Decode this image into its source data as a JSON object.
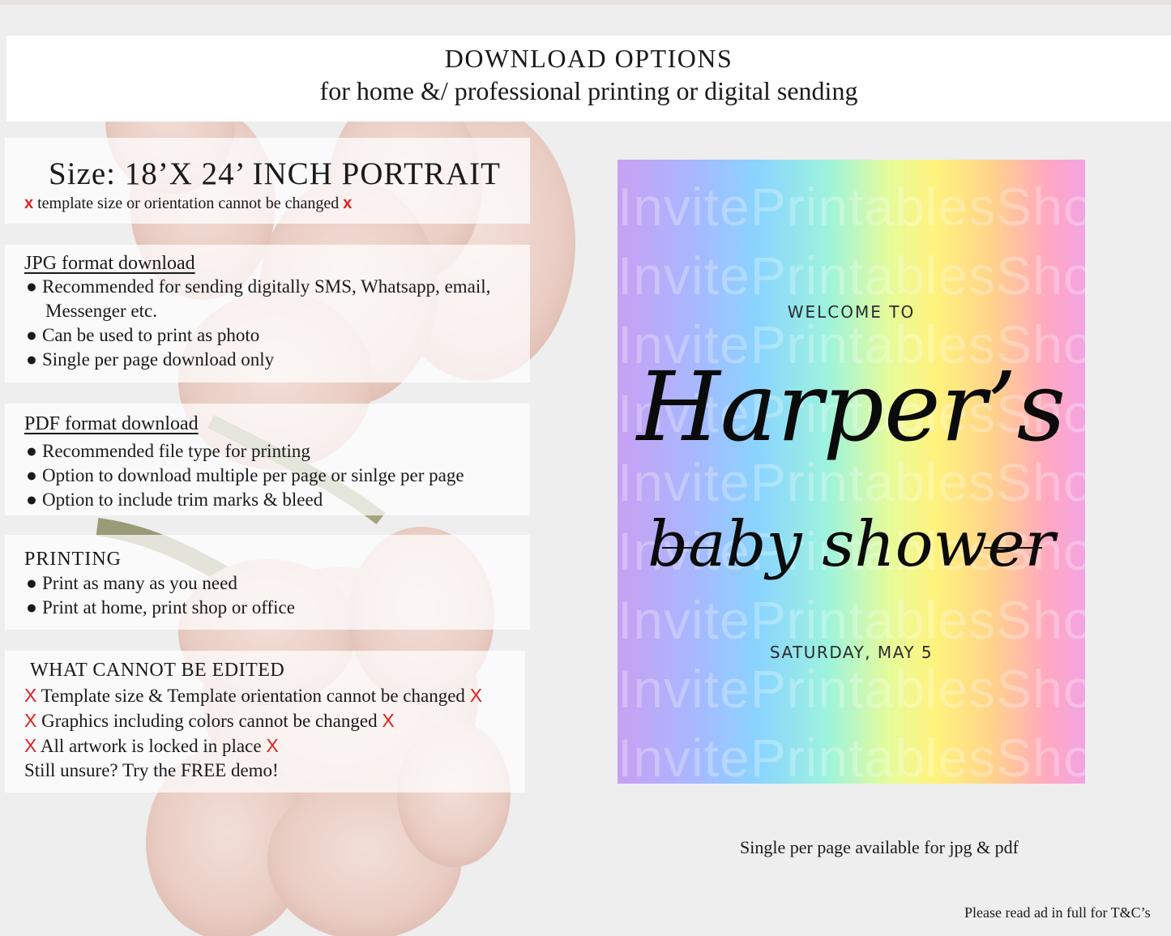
{
  "header": {
    "title": "DOWNLOAD OPTIONS",
    "subtitle": "for home &/ professional printing or digital sending"
  },
  "size_panel": {
    "title": "Size: 18’X 24’ INCH PORTRAIT",
    "note_mark": "x",
    "note": "template size or orientation cannot be changed"
  },
  "jpg_panel": {
    "title": "JPG format download",
    "bullet": "●",
    "items": [
      "Recommended for sending digitally SMS, Whatsapp, email,",
      "Messenger etc.",
      "Can be used to print as photo",
      "Single per page download only"
    ]
  },
  "pdf_panel": {
    "title": "PDF format download",
    "items": [
      "Recommended file type for printing",
      "Option to download multiple per page or sinlge per page",
      "Option to include trim marks & bleed"
    ]
  },
  "printing_panel": {
    "title": "PRINTING",
    "items": [
      "Print as many as you need",
      "Print at home, print shop or office"
    ]
  },
  "edit_panel": {
    "title": "WHAT CANNOT BE EDITED",
    "mark": "X",
    "items": [
      "Template size & Template orientation cannot be changed",
      "Graphics including colors cannot be changed",
      "All artwork is locked in place"
    ],
    "closing": "Still unsure? Try the FREE demo!"
  },
  "preview": {
    "watermark": "InvitePrintablesShop",
    "welcome": "WELCOME TO",
    "name": "Harper’s",
    "subtitle": "baby shower",
    "date": "SATURDAY, MAY 5"
  },
  "caption": "Single per page available for jpg & pdf",
  "footer": "Please read ad in full for T&C’s"
}
